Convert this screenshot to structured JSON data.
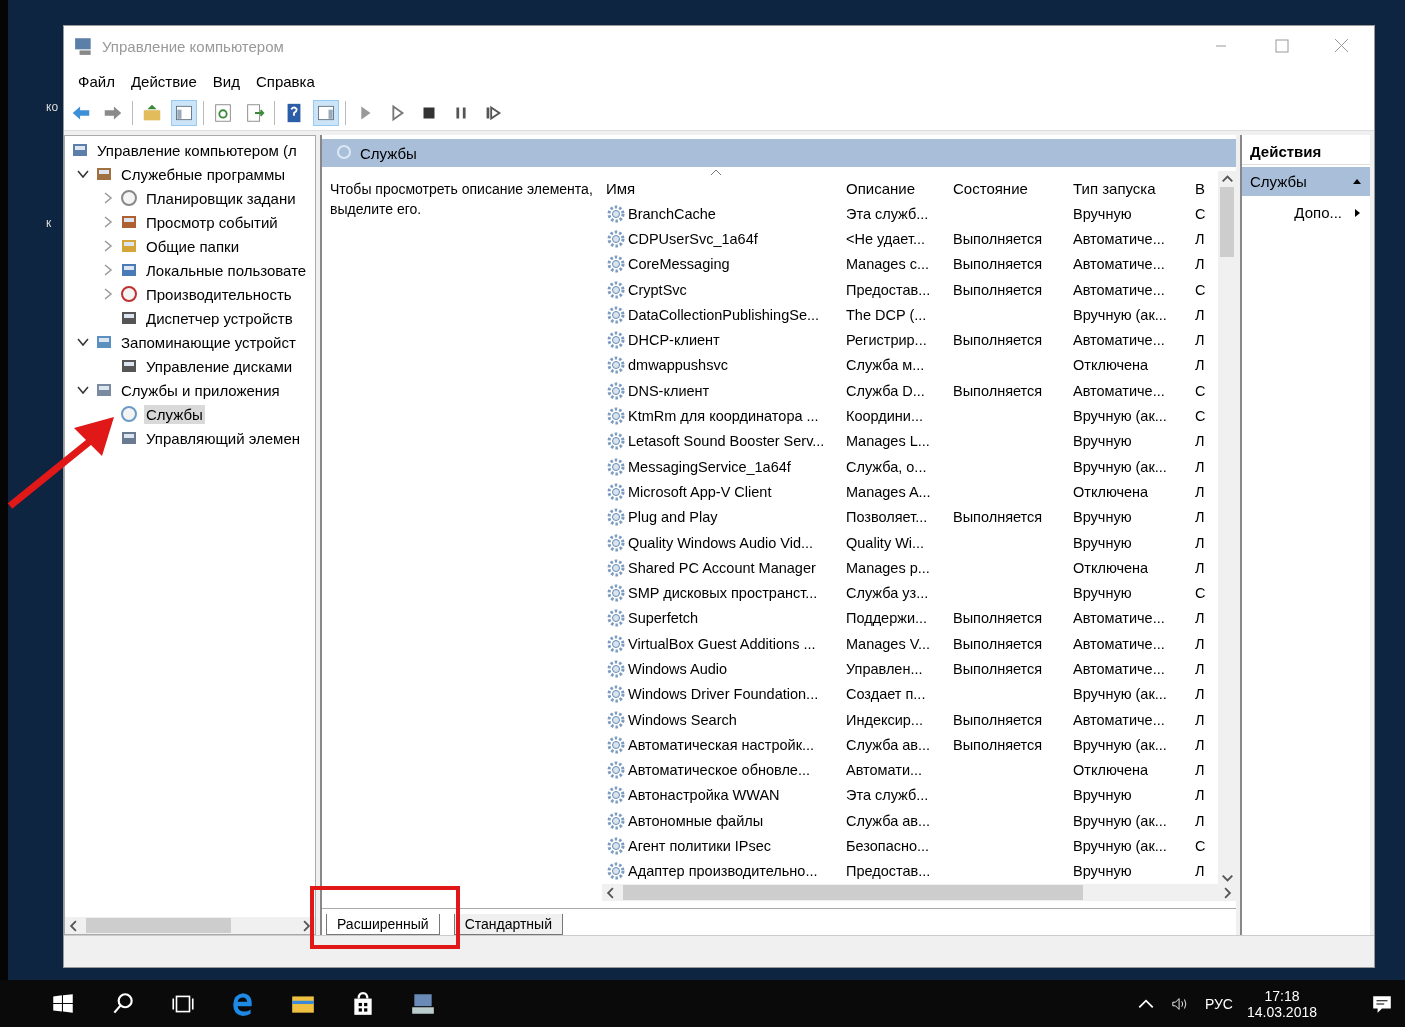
{
  "desktop_labels": [
    "ко",
    "к"
  ],
  "window": {
    "title": "Управление компьютером"
  },
  "menu": [
    "Файл",
    "Действие",
    "Вид",
    "Справка"
  ],
  "toolbar": [
    {
      "kind": "back",
      "pressed": false
    },
    {
      "kind": "forward",
      "pressed": false
    },
    {
      "kind": "sep"
    },
    {
      "kind": "folder-up",
      "pressed": false
    },
    {
      "kind": "tree-pane",
      "pressed": true
    },
    {
      "kind": "sep"
    },
    {
      "kind": "refresh",
      "pressed": false
    },
    {
      "kind": "export",
      "pressed": false
    },
    {
      "kind": "sep"
    },
    {
      "kind": "help",
      "pressed": false
    },
    {
      "kind": "action-pane",
      "pressed": true
    },
    {
      "kind": "sep"
    },
    {
      "kind": "play",
      "pressed": false
    },
    {
      "kind": "play-outline",
      "pressed": false
    },
    {
      "kind": "stop",
      "pressed": false
    },
    {
      "kind": "pause",
      "pressed": false
    },
    {
      "kind": "resume",
      "pressed": false
    }
  ],
  "tree": [
    {
      "label": "Управление компьютером (л",
      "kind": "computer",
      "selected": false,
      "children": [
        {
          "label": "Служебные программы",
          "kind": "tools",
          "expanded": true,
          "selected": false,
          "children": [
            {
              "label": "Планировщик задани",
              "kind": "clock",
              "expanded": false,
              "selected": false
            },
            {
              "label": "Просмотр событий",
              "kind": "log",
              "expanded": false,
              "selected": false
            },
            {
              "label": "Общие папки",
              "kind": "folder",
              "expanded": false,
              "selected": false
            },
            {
              "label": "Локальные пользовате",
              "kind": "users",
              "expanded": false,
              "selected": false
            },
            {
              "label": "Производительность",
              "kind": "gauge",
              "expanded": false,
              "selected": false
            },
            {
              "label": "Диспетчер устройств",
              "kind": "device",
              "selected": false
            }
          ]
        },
        {
          "label": "Запоминающие устройст",
          "kind": "storage",
          "expanded": true,
          "selected": false,
          "children": [
            {
              "label": "Управление дисками",
              "kind": "disk",
              "selected": false
            }
          ]
        },
        {
          "label": "Службы и приложения",
          "kind": "apps",
          "expanded": true,
          "selected": false,
          "children": [
            {
              "label": "Службы",
              "kind": "gear",
              "selected": true
            },
            {
              "label": "Управляющий элемен",
              "kind": "wmi",
              "selected": false
            }
          ]
        }
      ]
    }
  ],
  "panel": {
    "title": "Службы",
    "hint": "Чтобы просмотреть описание элемента, выделите его."
  },
  "columns": [
    {
      "label": "Имя",
      "sorted": true
    },
    {
      "label": "Описание",
      "sorted": false
    },
    {
      "label": "Состояние",
      "sorted": false
    },
    {
      "label": "Тип запуска",
      "sorted": false
    },
    {
      "label": "В",
      "sorted": false
    }
  ],
  "rows": [
    {
      "name": "BranchCache",
      "description": "Эта служб...",
      "status": "",
      "startup": "Вручную",
      "column_5": "С"
    },
    {
      "name": "CDPUserSvc_1a64f",
      "description": "<Не удает...",
      "status": "Выполняется",
      "startup": "Автоматиче...",
      "column_5": "Л"
    },
    {
      "name": "CoreMessaging",
      "description": "Manages c...",
      "status": "Выполняется",
      "startup": "Автоматиче...",
      "column_5": "Л"
    },
    {
      "name": "CryptSvc",
      "description": "Предостав...",
      "status": "Выполняется",
      "startup": "Автоматиче...",
      "column_5": "С"
    },
    {
      "name": "DataCollectionPublishingSe...",
      "description": "The DCP (...",
      "status": "",
      "startup": "Вручную (ак...",
      "column_5": "Л"
    },
    {
      "name": "DHCP-клиент",
      "description": "Регистрир...",
      "status": "Выполняется",
      "startup": "Автоматиче...",
      "column_5": "Л"
    },
    {
      "name": "dmwappushsvc",
      "description": "Служба м...",
      "status": "",
      "startup": "Отключена",
      "column_5": "Л"
    },
    {
      "name": "DNS-клиент",
      "description": "Служба D...",
      "status": "Выполняется",
      "startup": "Автоматиче...",
      "column_5": "С"
    },
    {
      "name": "KtmRm для координатора ...",
      "description": "Координи...",
      "status": "",
      "startup": "Вручную (ак...",
      "column_5": "С"
    },
    {
      "name": "Letasoft Sound Booster Serv...",
      "description": "Manages L...",
      "status": "",
      "startup": "Вручную",
      "column_5": "Л"
    },
    {
      "name": "MessagingService_1a64f",
      "description": "Служба, о...",
      "status": "",
      "startup": "Вручную (ак...",
      "column_5": "Л"
    },
    {
      "name": "Microsoft App-V Client",
      "description": "Manages A...",
      "status": "",
      "startup": "Отключена",
      "column_5": "Л"
    },
    {
      "name": "Plug and Play",
      "description": "Позволяет...",
      "status": "Выполняется",
      "startup": "Вручную",
      "column_5": "Л"
    },
    {
      "name": "Quality Windows Audio Vid...",
      "description": "Quality Wi...",
      "status": "",
      "startup": "Вручную",
      "column_5": "Л"
    },
    {
      "name": "Shared PC Account Manager",
      "description": "Manages p...",
      "status": "",
      "startup": "Отключена",
      "column_5": "Л"
    },
    {
      "name": "SMP дисковых пространст...",
      "description": "Служба уз...",
      "status": "",
      "startup": "Вручную",
      "column_5": "С"
    },
    {
      "name": "Superfetch",
      "description": "Поддержи...",
      "status": "Выполняется",
      "startup": "Автоматиче...",
      "column_5": "Л"
    },
    {
      "name": "VirtualBox Guest Additions ...",
      "description": "Manages V...",
      "status": "Выполняется",
      "startup": "Автоматиче...",
      "column_5": "Л"
    },
    {
      "name": "Windows Audio",
      "description": "Управлен...",
      "status": "Выполняется",
      "startup": "Автоматиче...",
      "column_5": "Л"
    },
    {
      "name": "Windows Driver Foundation...",
      "description": "Создает п...",
      "status": "",
      "startup": "Вручную (ак...",
      "column_5": "Л"
    },
    {
      "name": "Windows Search",
      "description": "Индексир...",
      "status": "Выполняется",
      "startup": "Автоматиче...",
      "column_5": "Л"
    },
    {
      "name": "Автоматическая настройк...",
      "description": "Служба ав...",
      "status": "Выполняется",
      "startup": "Вручную (ак...",
      "column_5": "Л"
    },
    {
      "name": "Автоматическое обновле...",
      "description": "Автомати...",
      "status": "",
      "startup": "Отключена",
      "column_5": "Л"
    },
    {
      "name": "Автонастройка WWAN",
      "description": "Эта служб...",
      "status": "",
      "startup": "Вручную",
      "column_5": "Л"
    },
    {
      "name": "Автономные файлы",
      "description": "Служба ав...",
      "status": "",
      "startup": "Вручную (ак...",
      "column_5": "Л"
    },
    {
      "name": "Агент политики IPsec",
      "description": "Безопасно...",
      "status": "",
      "startup": "Вручную (ак...",
      "column_5": "С"
    },
    {
      "name": "Адаптер производительно...",
      "description": "Предостав...",
      "status": "",
      "startup": "Вручную",
      "column_5": "Л"
    }
  ],
  "actions": {
    "title": "Действия",
    "sections": [
      {
        "label": "Службы",
        "expanded": true,
        "items": [
          "Допо..."
        ]
      }
    ]
  },
  "tabs": [
    {
      "label": "Расширенный",
      "selected": true
    },
    {
      "label": "Стандартный",
      "selected": false
    }
  ],
  "taskbar": {
    "apps": [
      {
        "kind": "search"
      },
      {
        "kind": "task-view"
      },
      {
        "kind": "browser"
      },
      {
        "kind": "explorer"
      },
      {
        "kind": "store"
      },
      {
        "kind": "management"
      }
    ],
    "tray": {
      "language": "РУС",
      "time": "17:18",
      "date": "14.03.2018"
    }
  }
}
